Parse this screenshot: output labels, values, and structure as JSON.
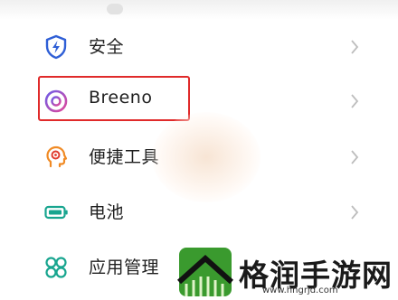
{
  "settings": {
    "items": [
      {
        "label": "安全",
        "icon": "shield-bolt-icon",
        "color": "#2f5fd6"
      },
      {
        "label": "Breeno",
        "icon": "breeno-ring-icon",
        "color": "#9b4fd4"
      },
      {
        "label": "便捷工具",
        "icon": "head-gear-icon",
        "color": "#f08a24"
      },
      {
        "label": "电池",
        "icon": "battery-icon",
        "color": "#18a58f"
      },
      {
        "label": "应用管理",
        "icon": "app-grid-icon",
        "color": "#18a58f"
      }
    ]
  },
  "annotation": {
    "highlight_color": "#e02a2a"
  },
  "watermark": {
    "brand": "格润手游网",
    "url": "www.hngrjd.com"
  }
}
